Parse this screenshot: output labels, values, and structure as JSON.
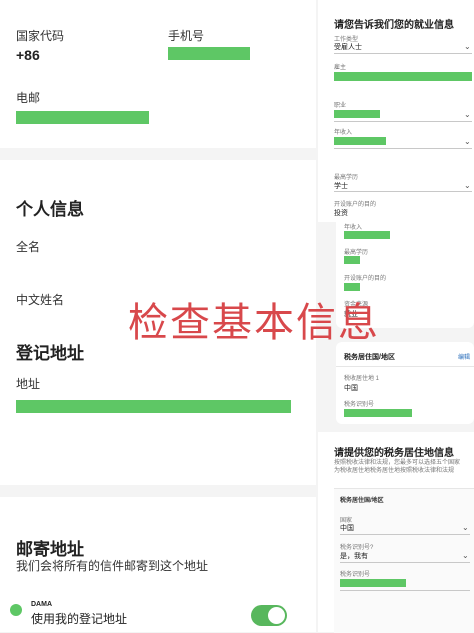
{
  "contact": {
    "country_code_label": "国家代码",
    "country_code_value": "+86",
    "phone_label": "手机号",
    "email_label": "电邮"
  },
  "personal": {
    "title": "个人信息",
    "full_name_label": "全名",
    "chinese_name_label": "中文姓名"
  },
  "registered_address": {
    "title": "登记地址",
    "address_label": "地址"
  },
  "mailing_address": {
    "title": "邮寄地址",
    "subtitle": "我们会将所有的信件邮寄到这个地址",
    "card_tag": "DAMA",
    "use_registered_label": "使用我的登记地址"
  },
  "overlay": {
    "title": "检查基本信息"
  },
  "employment": {
    "title": "请您告诉我们您的就业信息",
    "employment_type_label": "工作类型",
    "employment_type_value": "受雇人士",
    "employer_label": "雇主",
    "occupation_label": "职业",
    "annual_income_label": "年收入",
    "education_label": "最高学历",
    "education_value": "学士",
    "account_purpose_label": "开设账户的目的",
    "account_purpose_value": "投资"
  },
  "summary": {
    "annual_income_label": "年收入",
    "education_label": "最高学历",
    "account_purpose_label": "开设账户的目的",
    "source_of_funds_label": "资金来源",
    "source_of_funds_value": "就业"
  },
  "tax_card": {
    "title": "税务居住国/地区",
    "edit_label": "编辑",
    "residence_label": "税收居住地 1",
    "residence_value": "中国",
    "tin_label": "税务识别号"
  },
  "tax_info": {
    "title": "请提供您的税务居住地信息",
    "desc_line1": "按照税收法律和法规，您最多可以选择五个国家",
    "desc_line2": "为税收居住地税务居住地按照税收法律和法规",
    "section_label": "税务居住国/地区",
    "country_label": "国家",
    "country_value": "中国",
    "has_tin_label": "税务识别号?",
    "has_tin_value": "是，我有",
    "tin_label": "税务识别号"
  },
  "colors": {
    "redaction": "#5ec765",
    "accent": "#2a6ebb",
    "overlay_text": "#d8484b"
  }
}
